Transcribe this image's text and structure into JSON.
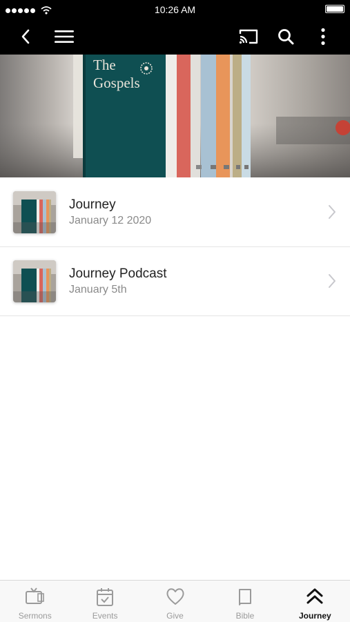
{
  "status_bar": {
    "time": "10:26 AM",
    "signal_icon": "signal-dots-icon",
    "wifi_icon": "wifi-icon",
    "battery_icon": "battery-icon"
  },
  "nav": {
    "back_icon": "chevron-left-icon",
    "menu_icon": "hamburger-menu-icon",
    "cast_icon": "cast-icon",
    "search_icon": "search-icon",
    "more_icon": "more-vertical-icon"
  },
  "hero": {
    "book_title_line1": "The",
    "book_title_line2": "Gospels"
  },
  "items": [
    {
      "title": "Journey",
      "subtitle": "January 12 2020"
    },
    {
      "title": "Journey Podcast",
      "subtitle": "January 5th"
    }
  ],
  "tabs": [
    {
      "label": "Sermons",
      "icon": "tv-icon",
      "active": false
    },
    {
      "label": "Events",
      "icon": "calendar-check-icon",
      "active": false
    },
    {
      "label": "Give",
      "icon": "heart-icon",
      "active": false
    },
    {
      "label": "Bible",
      "icon": "book-icon",
      "active": false
    },
    {
      "label": "Journey",
      "icon": "double-chevron-up-icon",
      "active": true
    }
  ],
  "colors": {
    "header_bg": "#000000",
    "tab_active": "#111111",
    "tab_inactive": "#9a9a9a"
  }
}
